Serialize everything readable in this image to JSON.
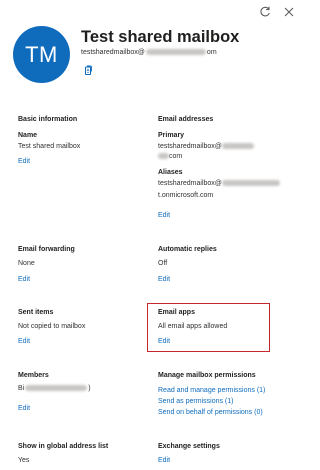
{
  "header": {
    "refresh_icon": "refresh-icon",
    "close_icon": "close-icon",
    "avatar_initials": "TM",
    "mailbox_name": "Test shared mailbox",
    "email_prefix": "testsharedmailbox@",
    "email_suffix": "om",
    "copy_icon": "copy-icon"
  },
  "basic_information": {
    "title": "Basic information",
    "name_label": "Name",
    "name_value": "Test shared mailbox",
    "edit": "Edit"
  },
  "email_addresses": {
    "title": "Email addresses",
    "primary_label": "Primary",
    "primary_prefix": "testsharedmailbox@",
    "primary_line2_suffix": "com",
    "aliases_label": "Aliases",
    "alias_prefix": "testsharedmailbox@",
    "alias_line2": "t.onmicrosoft.com",
    "edit": "Edit"
  },
  "email_forwarding": {
    "title": "Email forwarding",
    "value": "None",
    "edit": "Edit"
  },
  "automatic_replies": {
    "title": "Automatic replies",
    "value": "Off",
    "edit": "Edit"
  },
  "sent_items": {
    "title": "Sent items",
    "value": "Not copied to mailbox",
    "edit": "Edit"
  },
  "email_apps": {
    "title": "Email apps",
    "value": "All email apps allowed",
    "edit": "Edit",
    "highlight_color": "#c4262e"
  },
  "members": {
    "title": "Members",
    "value_prefix": "Bi",
    "value_suffix": ")",
    "edit": "Edit"
  },
  "manage_permissions": {
    "title": "Manage mailbox permissions",
    "links": [
      "Read and manage permissions (1)",
      "Send as permissions (1)",
      "Send on behalf of permissions (0)"
    ]
  },
  "global_address_list": {
    "title": "Show in global address list",
    "value": "Yes"
  },
  "exchange_settings": {
    "title": "Exchange settings",
    "edit": "Edit"
  },
  "colors": {
    "accent": "#0f6cbd",
    "text": "#323130"
  }
}
